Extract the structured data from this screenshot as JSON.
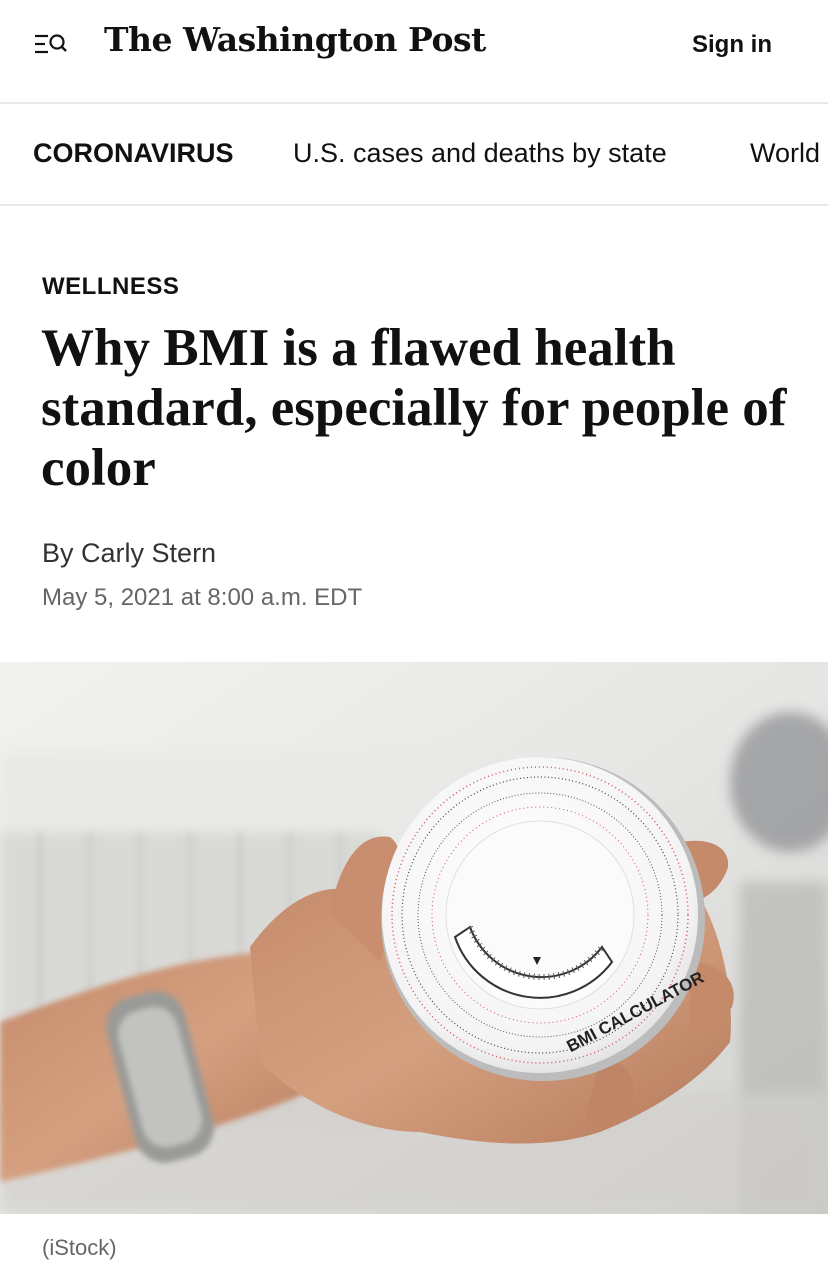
{
  "header": {
    "logo_text": "The Washington Post",
    "sign_in_label": "Sign in",
    "menu_icon": "menu-search-icon"
  },
  "subnav": {
    "section_label": "CORONAVIRUS",
    "links": [
      "U.S. cases and deaths by state",
      "World"
    ]
  },
  "article": {
    "kicker": "WELLNESS",
    "headline": "Why BMI is a flawed health standard, especially for people of color",
    "byline_prefix": "By",
    "author": "Carly Stern",
    "date": "May 5, 2021 at 8:00 a.m. EDT"
  },
  "image": {
    "device_label": "BMI CALCULATOR",
    "caption": "(iStock)"
  },
  "colors": {
    "text": "#111111",
    "muted": "#666666",
    "divider": "#e8e8e8",
    "scale_red": "#d8505a"
  }
}
